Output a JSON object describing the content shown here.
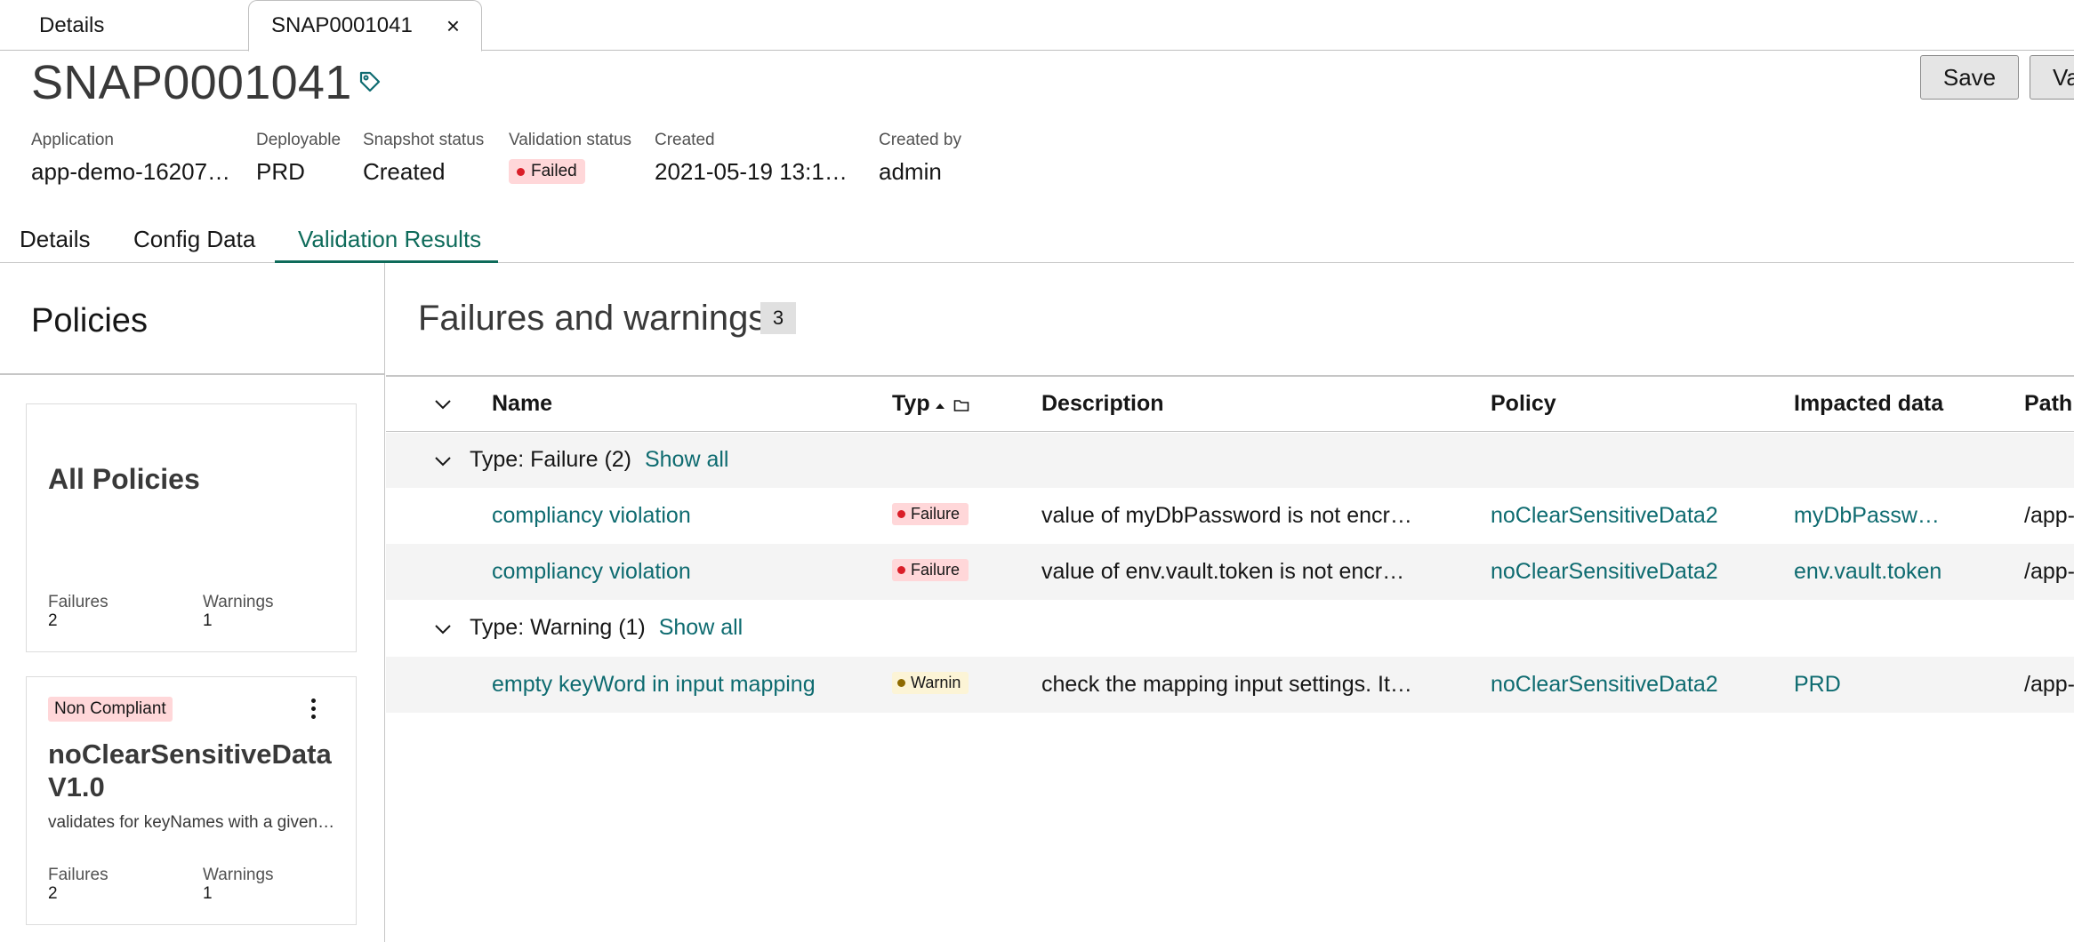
{
  "top_tabs": {
    "details_label": "Details",
    "snapshot_label": "SNAP0001041",
    "close_glyph": "×"
  },
  "header": {
    "title": "SNAP0001041",
    "save_label": "Save",
    "validate_label": "Va"
  },
  "meta": {
    "application": {
      "label": "Application",
      "value": "app-demo-16207…"
    },
    "deployable": {
      "label": "Deployable",
      "value": "PRD"
    },
    "snapshot_status": {
      "label": "Snapshot status",
      "value": "Created"
    },
    "validation_status": {
      "label": "Validation status",
      "value": "Failed"
    },
    "created": {
      "label": "Created",
      "value": "2021-05-19 13:1…"
    },
    "created_by": {
      "label": "Created by",
      "value": "admin"
    }
  },
  "sub_tabs": {
    "details": "Details",
    "config_data": "Config Data",
    "validation_results": "Validation Results"
  },
  "policies_panel": {
    "title": "Policies",
    "all_policies": {
      "title": "All Policies",
      "failures_label": "Failures",
      "failures_value": "2",
      "warnings_label": "Warnings",
      "warnings_value": "1"
    },
    "policy_card": {
      "badge": "Non Compliant",
      "name_line1": "noClearSensitiveData",
      "name_line2": "V1.0",
      "description": "validates for keyNames with a given…",
      "failures_label": "Failures",
      "failures_value": "2",
      "warnings_label": "Warnings",
      "warnings_value": "1"
    }
  },
  "failures": {
    "title": "Failures and warnings",
    "count": "3",
    "columns": {
      "name": "Name",
      "type": "Typ",
      "description": "Description",
      "policy": "Policy",
      "impacted": "Impacted data",
      "path": "Path"
    },
    "groups": [
      {
        "label": "Type: Failure (2)",
        "show_all": "Show all"
      },
      {
        "label": "Type: Warning (1)",
        "show_all": "Show all"
      }
    ],
    "rows": [
      {
        "name": "compliancy violation",
        "type": "Failure",
        "description": "value of myDbPassword is not encr…",
        "policy": "noClearSensitiveData2",
        "impacted": "myDbPassw…",
        "path": "/app-"
      },
      {
        "name": "compliancy violation",
        "type": "Failure",
        "description": "value of env.vault.token is not encr…",
        "policy": "noClearSensitiveData2",
        "impacted": "env.vault.token",
        "path": "/app-"
      },
      {
        "name": "empty keyWord in input mapping",
        "type": "Warnin",
        "description": "check the mapping input settings. It…",
        "policy": "noClearSensitiveData2",
        "impacted": "PRD",
        "path": "/app-"
      }
    ]
  },
  "colors": {
    "accent": "#0e6b5a",
    "link": "#0e6b70",
    "failure_badge": "#ffd7d9",
    "warning_badge": "#fcf4d6"
  },
  "icons": [
    "tag-icon",
    "close-icon",
    "chevron-down-icon",
    "sort-ascending-icon",
    "folder-icon",
    "overflow-menu-icon"
  ]
}
